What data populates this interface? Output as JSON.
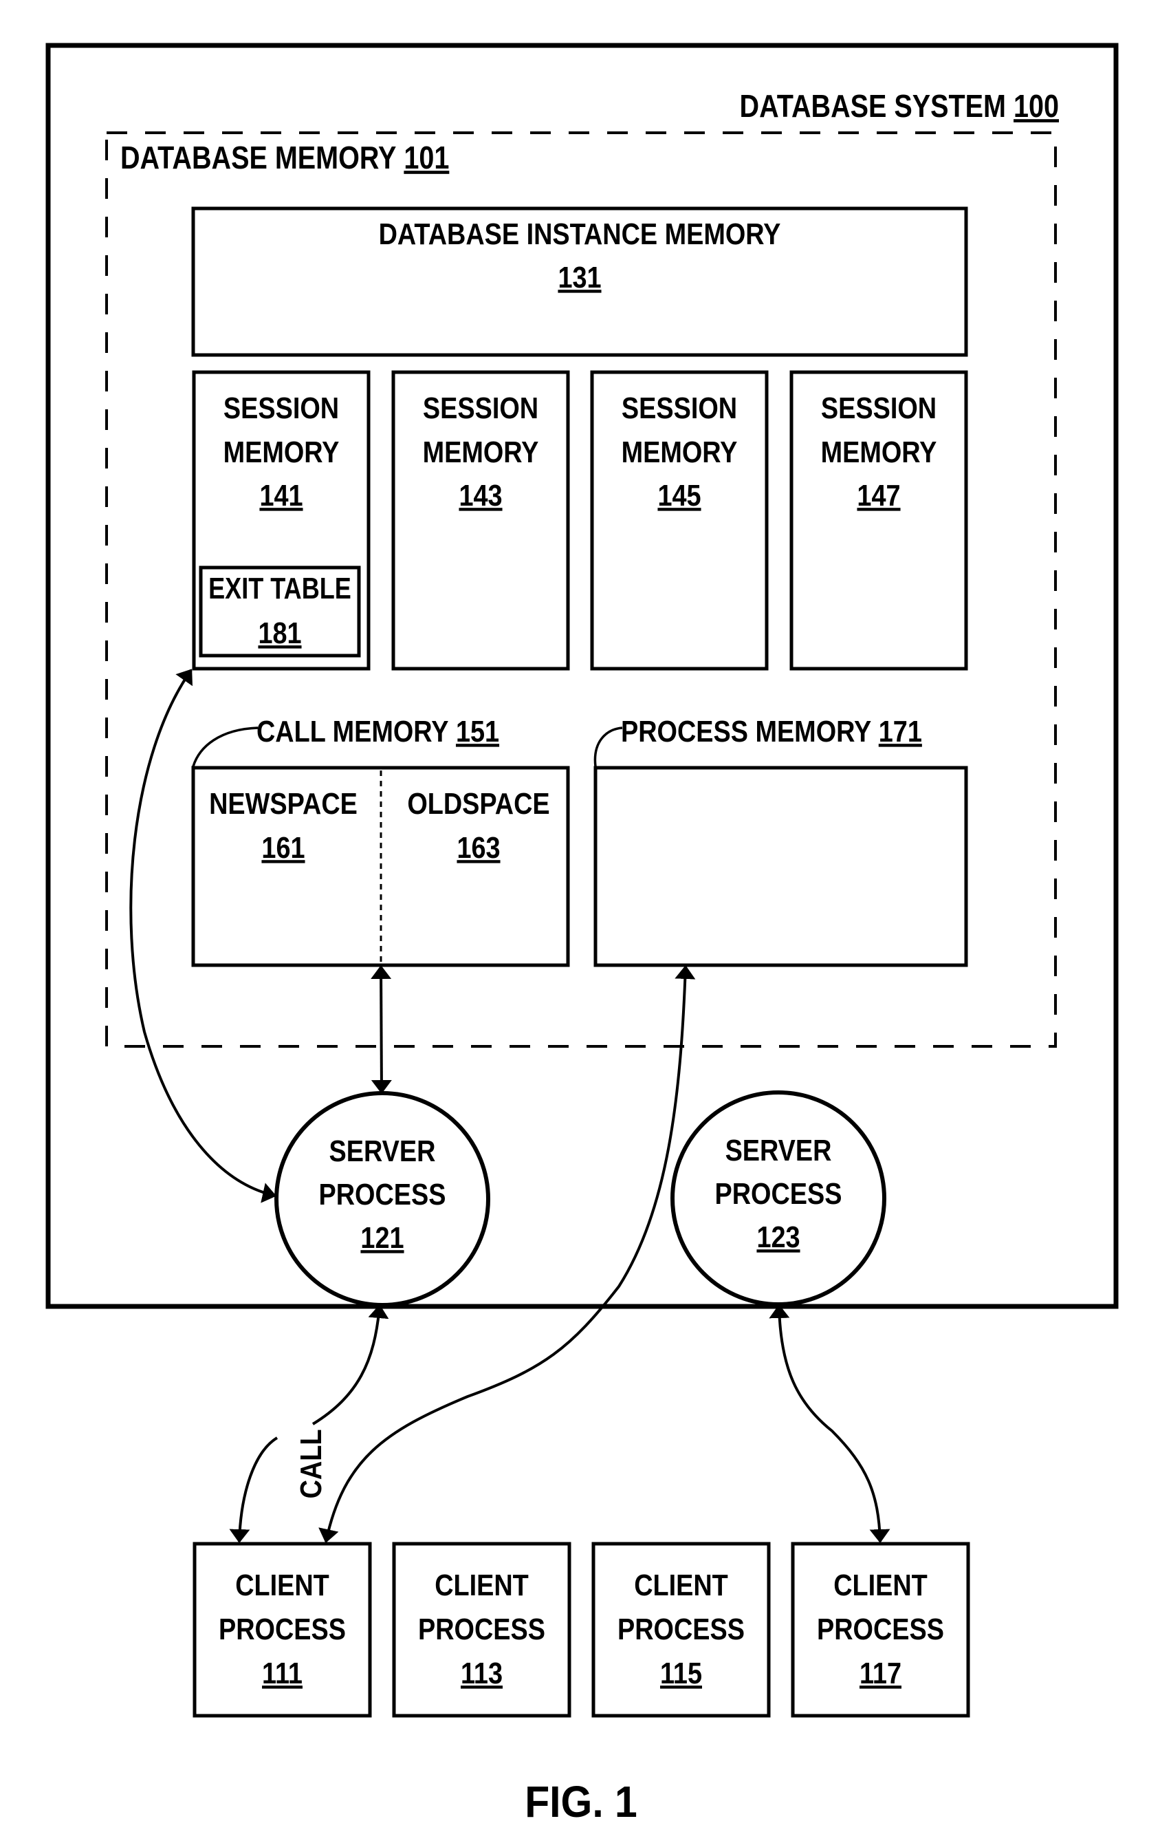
{
  "figure": {
    "caption": "FIG. 1",
    "database_system": {
      "label": "DATABASE SYSTEM",
      "ref": "100"
    },
    "database_memory": {
      "label": "DATABASE MEMORY",
      "ref": "101"
    },
    "instance_memory": {
      "line1": "DATABASE INSTANCE MEMORY",
      "ref": "131"
    },
    "session_memories": [
      {
        "line1": "SESSION",
        "line2": "MEMORY",
        "ref": "141"
      },
      {
        "line1": "SESSION",
        "line2": "MEMORY",
        "ref": "143"
      },
      {
        "line1": "SESSION",
        "line2": "MEMORY",
        "ref": "145"
      },
      {
        "line1": "SESSION",
        "line2": "MEMORY",
        "ref": "147"
      }
    ],
    "exit_table": {
      "label": "EXIT TABLE",
      "ref": "181"
    },
    "call_memory": {
      "label": "CALL MEMORY",
      "ref": "151",
      "newspace": {
        "label": "NEWSPACE",
        "ref": "161"
      },
      "oldspace": {
        "label": "OLDSPACE",
        "ref": "163"
      }
    },
    "process_memory": {
      "label": "PROCESS MEMORY",
      "ref": "171"
    },
    "server_processes": [
      {
        "line1": "SERVER",
        "line2": "PROCESS",
        "ref": "121"
      },
      {
        "line1": "SERVER",
        "line2": "PROCESS",
        "ref": "123"
      }
    ],
    "client_processes": [
      {
        "line1": "CLIENT",
        "line2": "PROCESS",
        "ref": "111"
      },
      {
        "line1": "CLIENT",
        "line2": "PROCESS",
        "ref": "113"
      },
      {
        "line1": "CLIENT",
        "line2": "PROCESS",
        "ref": "115"
      },
      {
        "line1": "CLIENT",
        "line2": "PROCESS",
        "ref": "117"
      }
    ],
    "connections": [
      {
        "from": "server-process-121",
        "to": "session-memory-141",
        "type": "bidirectional"
      },
      {
        "from": "server-process-121",
        "to": "call-memory-151",
        "type": "bidirectional"
      },
      {
        "from": "client-process-111",
        "to": "process-memory-171",
        "type": "bidirectional"
      },
      {
        "from": "client-process-111",
        "to": "server-process-121",
        "type": "bidirectional",
        "label": "CALL"
      },
      {
        "from": "client-process-117",
        "to": "server-process-123",
        "type": "bidirectional"
      }
    ]
  }
}
